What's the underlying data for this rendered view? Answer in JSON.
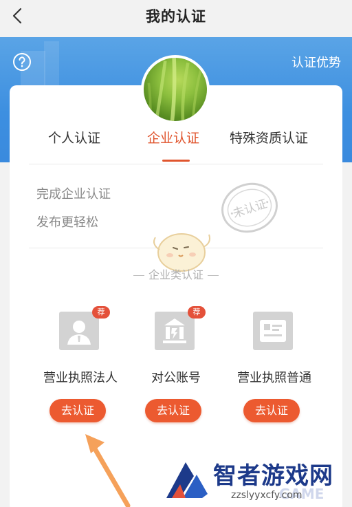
{
  "header": {
    "title": "我的认证"
  },
  "banner": {
    "advantage_label": "认证优势"
  },
  "tabs": [
    {
      "label": "个人认证"
    },
    {
      "label": "企业认证",
      "active": true
    },
    {
      "label": "特殊资质认证"
    }
  ],
  "promo": {
    "line1": "完成企业认证",
    "line2": "发布更轻松",
    "stamp": "未认证"
  },
  "section": {
    "title": "企业类认证"
  },
  "options": [
    {
      "label": "营业执照法人",
      "badge": "荐",
      "button": "去认证",
      "icon": "person-id-icon"
    },
    {
      "label": "对公账号",
      "badge": "荐",
      "button": "去认证",
      "icon": "bank-icon"
    },
    {
      "label": "营业执照普通",
      "badge": "",
      "button": "去认证",
      "icon": "license-card-icon"
    }
  ],
  "watermark": {
    "title": "智者游戏网",
    "url": "zzslyyxcfy.com",
    "game": "GAME"
  },
  "colors": {
    "accent": "#ec5a30",
    "banner": "#3d8fe0",
    "badge": "#e4513a"
  }
}
